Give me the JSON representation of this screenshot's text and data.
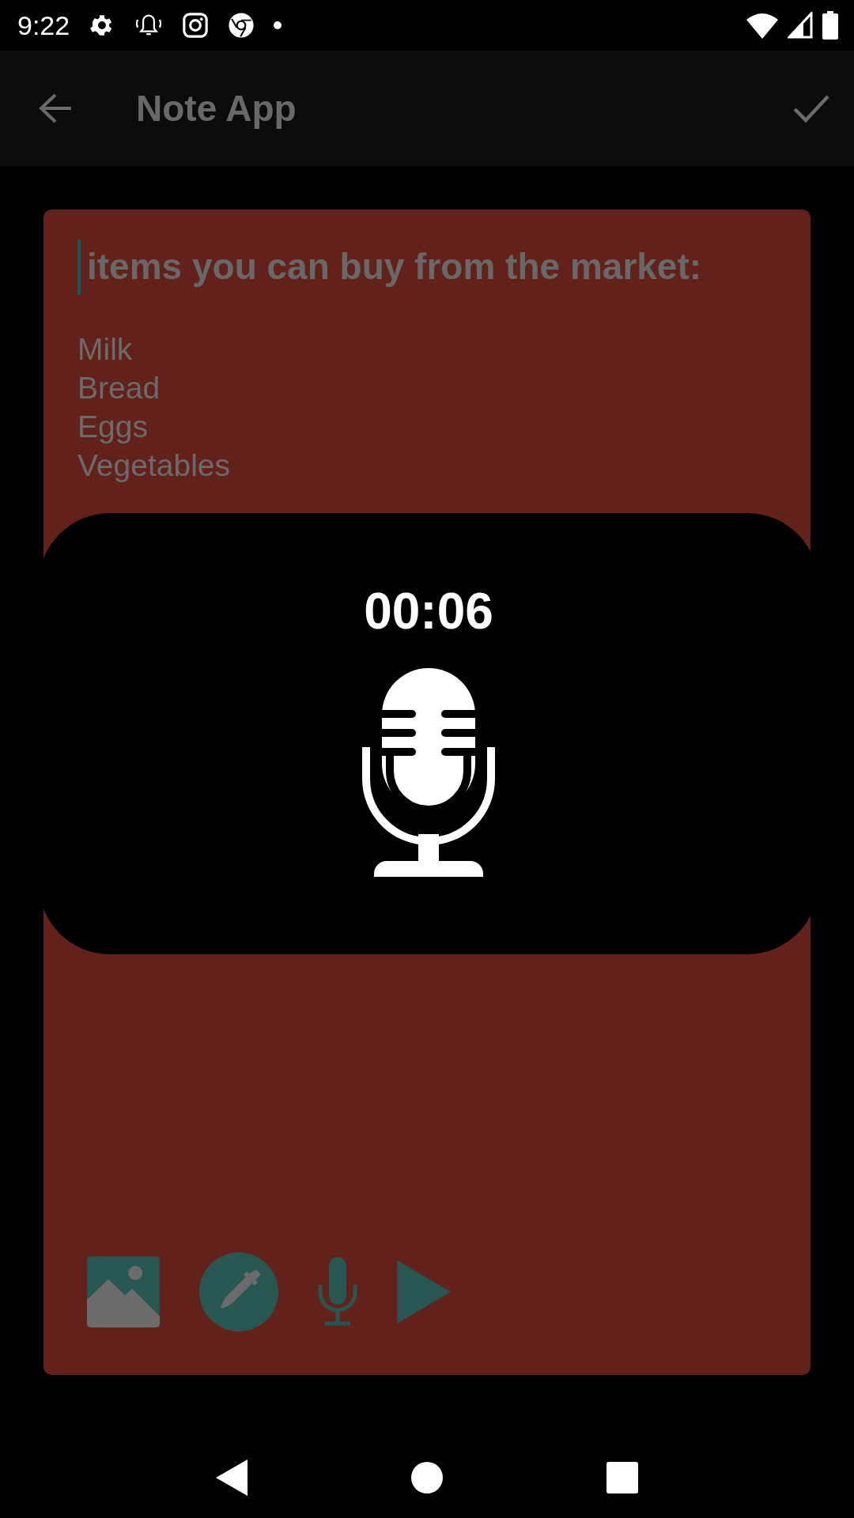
{
  "status_bar": {
    "time": "9:22"
  },
  "app_bar": {
    "title": "Note App"
  },
  "note": {
    "title": "items you can buy from the market:",
    "lines": [
      "Milk",
      "Bread",
      "Eggs",
      "Vegetables"
    ]
  },
  "recording_dialog": {
    "timer": "00:06"
  }
}
